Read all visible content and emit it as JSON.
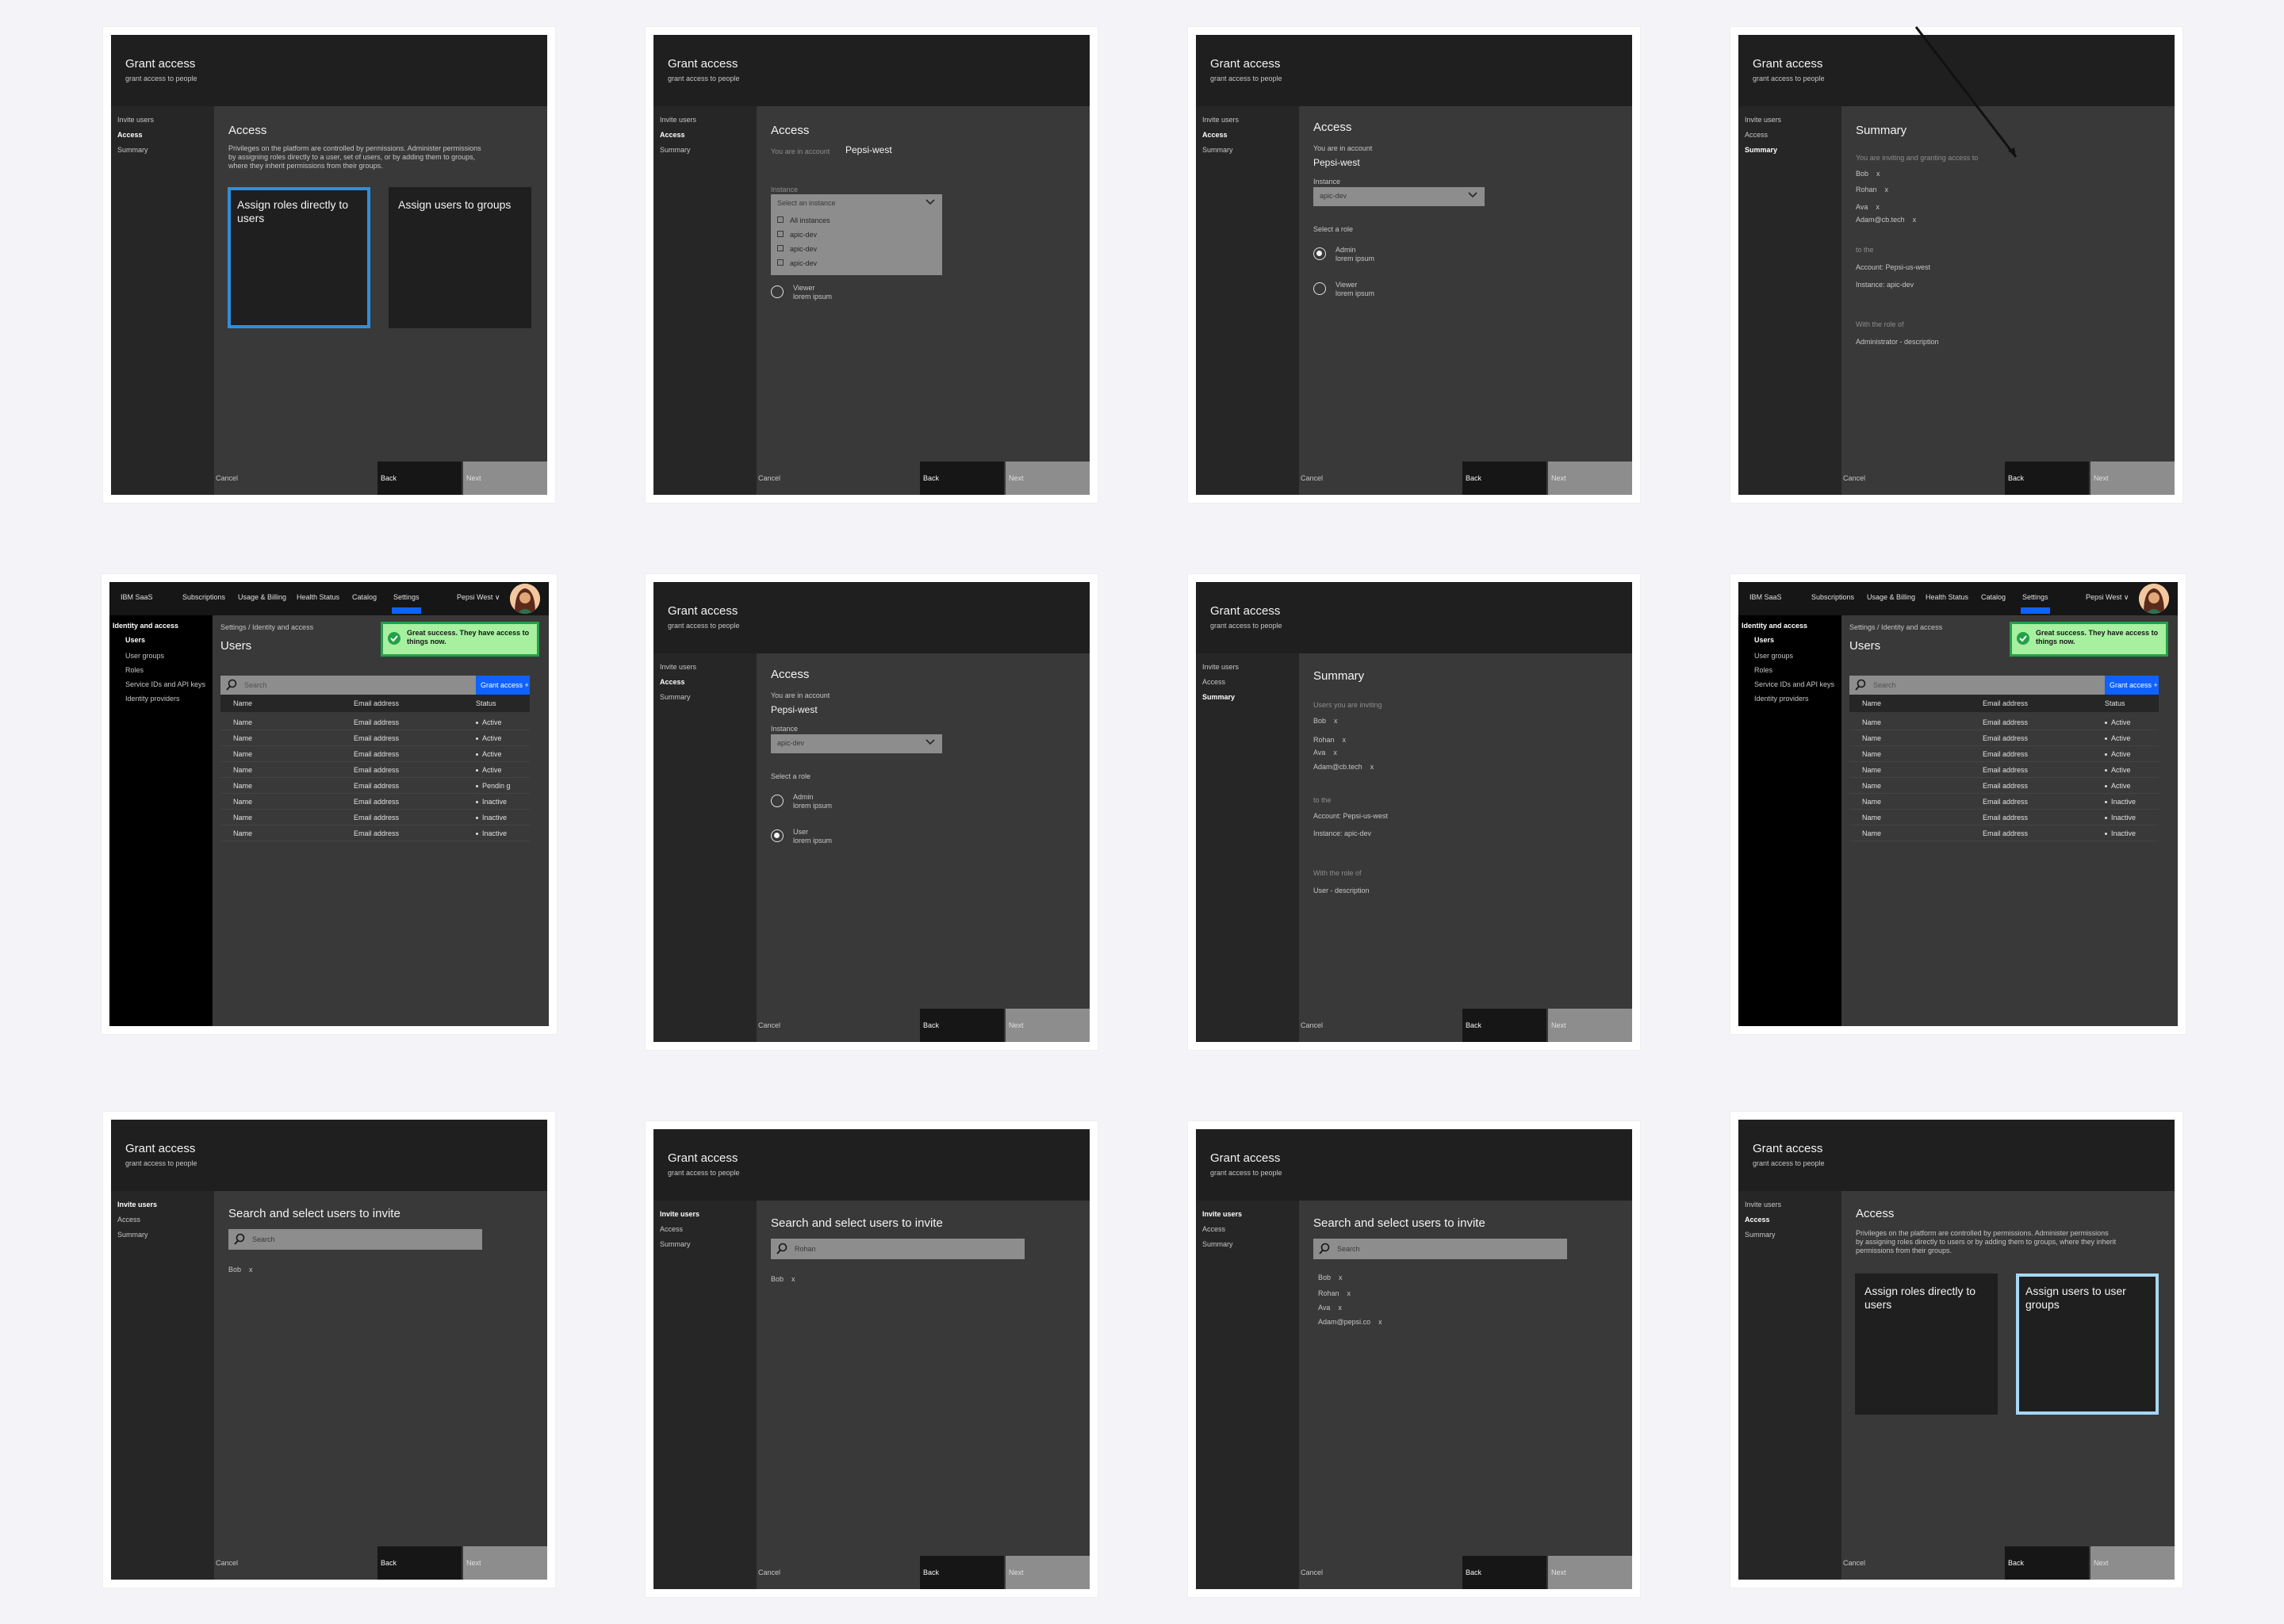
{
  "wizard": {
    "title": "Grant access",
    "subtitle": "grant access to people",
    "steps": [
      "Invite users",
      "Access",
      "Summary"
    ],
    "cancel": "Cancel",
    "back": "Back",
    "next": "Next"
  },
  "access": {
    "heading": "Access",
    "description": "Privileges on the platform are controlled by permissions. Administer permissions by assigning roles directly to a user, set of users, or by adding them to groups, where they inherit permissions from their groups.",
    "description2": "Privileges on the platform are controlled by permissions. Administer permissions by assigning roles directly to users or by adding them to groups, where they inherit permissions from their groups.",
    "tile_roles": "Assign roles directly to users",
    "tile_groups": "Assign users to groups",
    "tile_user_groups": "Assign users to user groups",
    "in_account_label": "You are in account",
    "account_name": "Pepsi-west",
    "instance_label": "Instance",
    "instance_placeholder": "Select an instance",
    "instance_value": "apic-dev",
    "instance_options": [
      "All instances",
      "apic-dev",
      "apic-dev",
      "apic-dev"
    ],
    "select_role_label": "Select a role",
    "role_admin": "Admin",
    "role_viewer": "Viewer",
    "role_user": "User",
    "role_desc": "lorem ipsum",
    "role_desc_alt": "lorem ipsum"
  },
  "summary": {
    "heading": "Summary",
    "inviting_label": "You are inviting and granting access to",
    "users_label": "Users you are inviting",
    "to_label": "to the",
    "account_line": "Account:  Pepsi-us-west",
    "instance_line": "Instance: apic-dev",
    "role_label": "With the role of",
    "role_admin_line": "Administrator - description",
    "role_user_line": "User - description"
  },
  "invite": {
    "heading": "Search and select users to invite",
    "search_placeholder": "Search",
    "search_value_rohan": "Rohan",
    "users": [
      "Bob",
      "Rohan",
      "Ava",
      "Adam@cb.tech"
    ],
    "users_alt": [
      "Bob",
      "Rohan",
      "Ava",
      "Adam@pepsi.co"
    ],
    "remove": "x"
  },
  "app": {
    "brand": "IBM SaaS",
    "nav": [
      "Subscriptions",
      "Usage & Billing",
      "Health Status",
      "Catalog",
      "Settings"
    ],
    "account": "Pepsi West ∨",
    "sidebar_title": "Identity and access",
    "sidebar_items": [
      "Users",
      "User groups",
      "Roles",
      "Service IDs and API keys",
      "Identity providers"
    ],
    "breadcrumb": "Settings / Identity and access",
    "page_title": "Users",
    "toast": "Great success. They have access to things now.",
    "search_placeholder": "Search",
    "grant_button": "Grant access +",
    "columns": [
      "Name",
      "Email address",
      "Status"
    ],
    "rows": [
      [
        "Name",
        "Email address",
        "Active"
      ],
      [
        "Name",
        "Email address",
        "Active"
      ],
      [
        "Name",
        "Email address",
        "Active"
      ],
      [
        "Name",
        "Email address",
        "Active"
      ],
      [
        "Name",
        "Email address",
        "Pendin g"
      ],
      [
        "Name",
        "Email address",
        "Inactive"
      ],
      [
        "Name",
        "Email address",
        "Inactive"
      ],
      [
        "Name",
        "Email address",
        "Inactive"
      ]
    ],
    "rows_b": [
      [
        "Name",
        "Email address",
        "Active"
      ],
      [
        "Name",
        "Email address",
        "Active"
      ],
      [
        "Name",
        "Email address",
        "Active"
      ],
      [
        "Name",
        "Email address",
        "Active"
      ],
      [
        "Name",
        "Email address",
        "Active"
      ],
      [
        "Name",
        "Email address",
        "Inactive"
      ],
      [
        "Name",
        "Email address",
        "Inactive"
      ],
      [
        "Name",
        "Email address",
        "Inactive"
      ]
    ]
  },
  "colors": {
    "accent_blue": "#0f62fe",
    "selected_tile": "#2d8fe0",
    "selected_tile_light": "#a6d7f5",
    "success_bg": "#a7f0a0",
    "success_border": "#24a148"
  },
  "icons": [
    "chevron-down-icon",
    "search-icon",
    "checkmark-icon",
    "avatar",
    "annotation-arrow"
  ]
}
